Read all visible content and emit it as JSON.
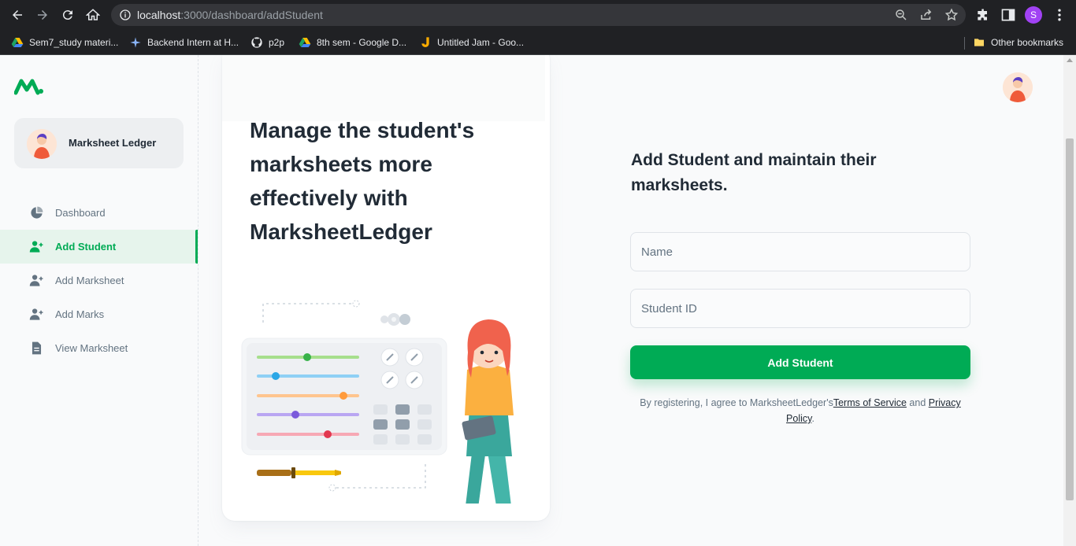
{
  "browser": {
    "url_host": "localhost",
    "url_path": ":3000/dashboard/addStudent",
    "profile_initial": "S",
    "bookmarks": [
      {
        "label": "Sem7_study materi...",
        "icon": "google-drive-icon"
      },
      {
        "label": "Backend Intern at H...",
        "icon": "sparkle-icon"
      },
      {
        "label": "p2p",
        "icon": "github-icon"
      },
      {
        "label": "8th sem - Google D...",
        "icon": "google-drive-icon"
      },
      {
        "label": "Untitled Jam - Goo...",
        "icon": "jamboard-icon"
      }
    ],
    "other_bookmarks": "Other bookmarks"
  },
  "sidebar": {
    "account_name": "Marksheet Ledger",
    "items": [
      {
        "label": "Dashboard",
        "icon": "pie-chart-icon",
        "active": false
      },
      {
        "label": "Add Student",
        "icon": "person-add-icon",
        "active": true
      },
      {
        "label": "Add Marksheet",
        "icon": "person-add-icon",
        "active": false
      },
      {
        "label": "Add Marks",
        "icon": "person-add-icon",
        "active": false
      },
      {
        "label": "View Marksheet",
        "icon": "document-icon",
        "active": false
      }
    ]
  },
  "hero": {
    "title": "Manage the student's marksheets more effectively with MarksheetLedger"
  },
  "form": {
    "heading": "Add Student and maintain their marksheets.",
    "name_placeholder": "Name",
    "student_id_placeholder": "Student ID",
    "submit_label": "Add Student",
    "terms_prefix": "By registering, I agree to MarksheetLedger's",
    "terms_link": "Terms of Service",
    "terms_and": " and ",
    "privacy_link": "Privacy Policy",
    "terms_suffix": "."
  },
  "colors": {
    "primary": "#00ab55",
    "text": "#212b36",
    "muted": "#637381"
  }
}
